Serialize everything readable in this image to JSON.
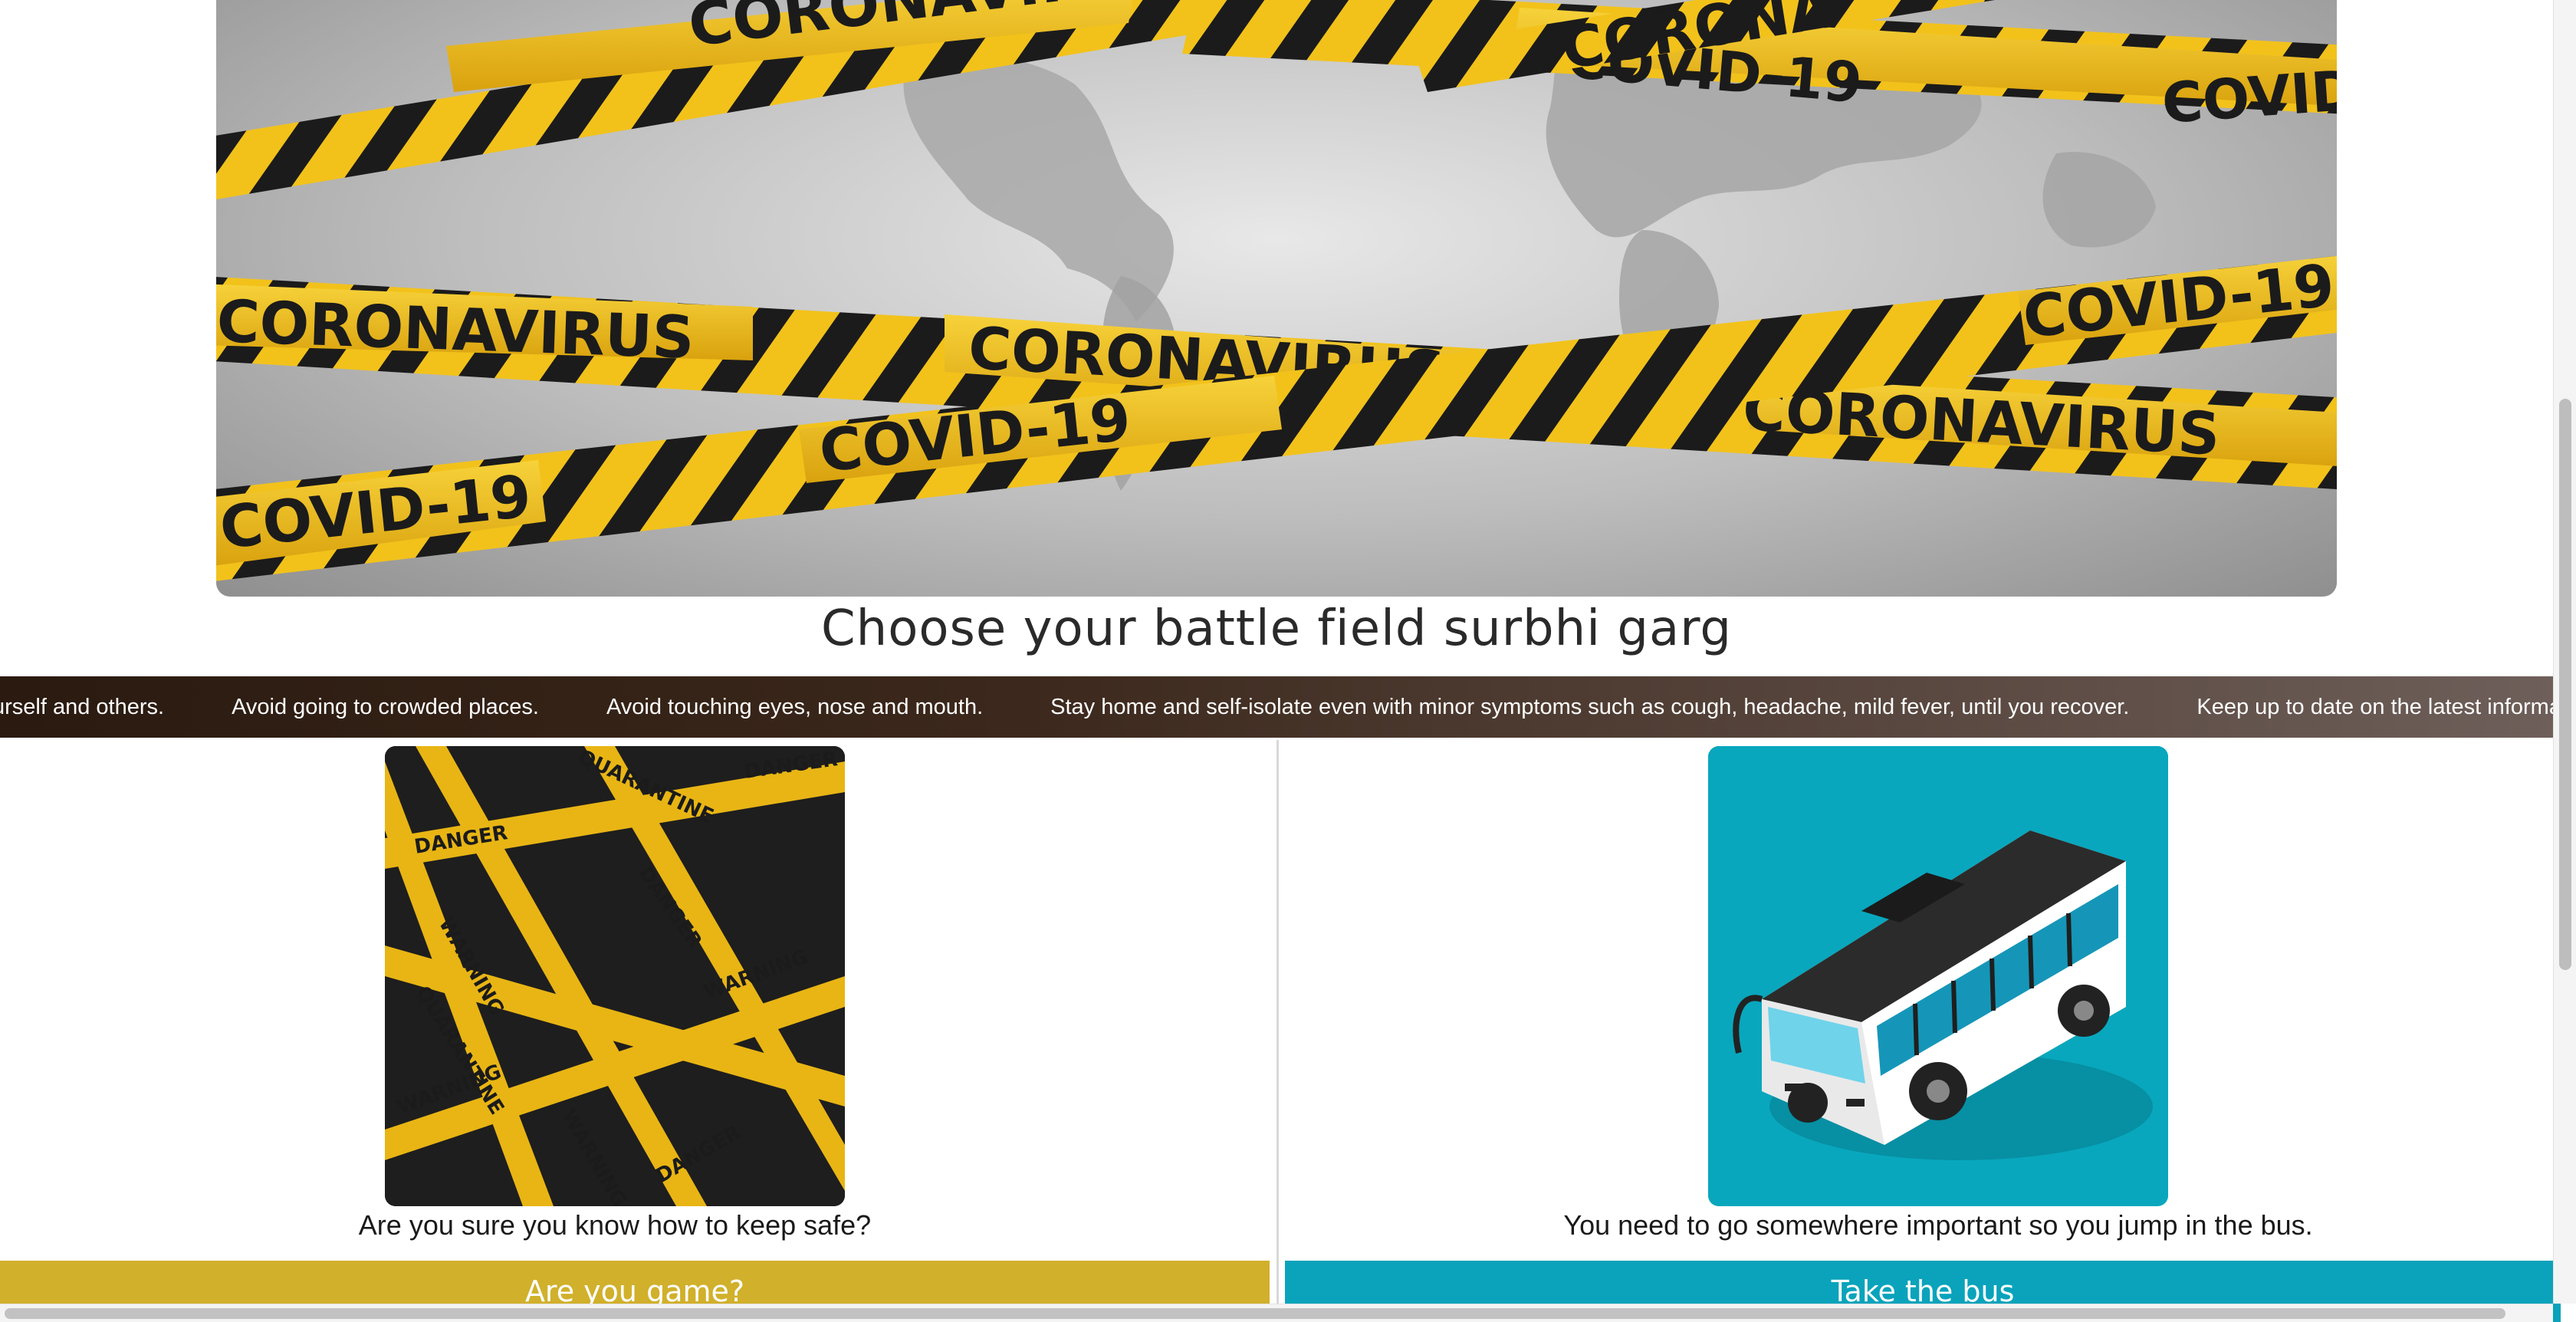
{
  "hero": {
    "tape_words": [
      "CORONAVIRUS",
      "COVID-19"
    ],
    "colors": {
      "tape_yellow": "#f2c21b",
      "tape_black": "#1b1b1b",
      "map_gray": "#9e9e9e"
    }
  },
  "title": "Choose your battle field surbhi garg",
  "ticker": {
    "items": [
      "urself and others.",
      "Avoid going to crowded places.",
      "Avoid touching eyes, nose and mouth.",
      "Stay home and self-isolate even with minor symptoms such as cough, headache, mild fever, until you recover.",
      "Keep up to date on the latest information fro"
    ]
  },
  "choices": {
    "left": {
      "image_icon": "danger-tape-image",
      "image_words": [
        "DANGER",
        "WARNING",
        "QUARANTINE",
        "COVID-19"
      ],
      "question": "Are you sure you know how to keep safe?",
      "button_label": "Are you game?",
      "button_color": "#d1b02b"
    },
    "right": {
      "image_icon": "bus-image",
      "question": "You need to go somewhere important so you jump in the bus.",
      "button_label": "Take the bus",
      "button_color": "#0aa3bb"
    }
  }
}
